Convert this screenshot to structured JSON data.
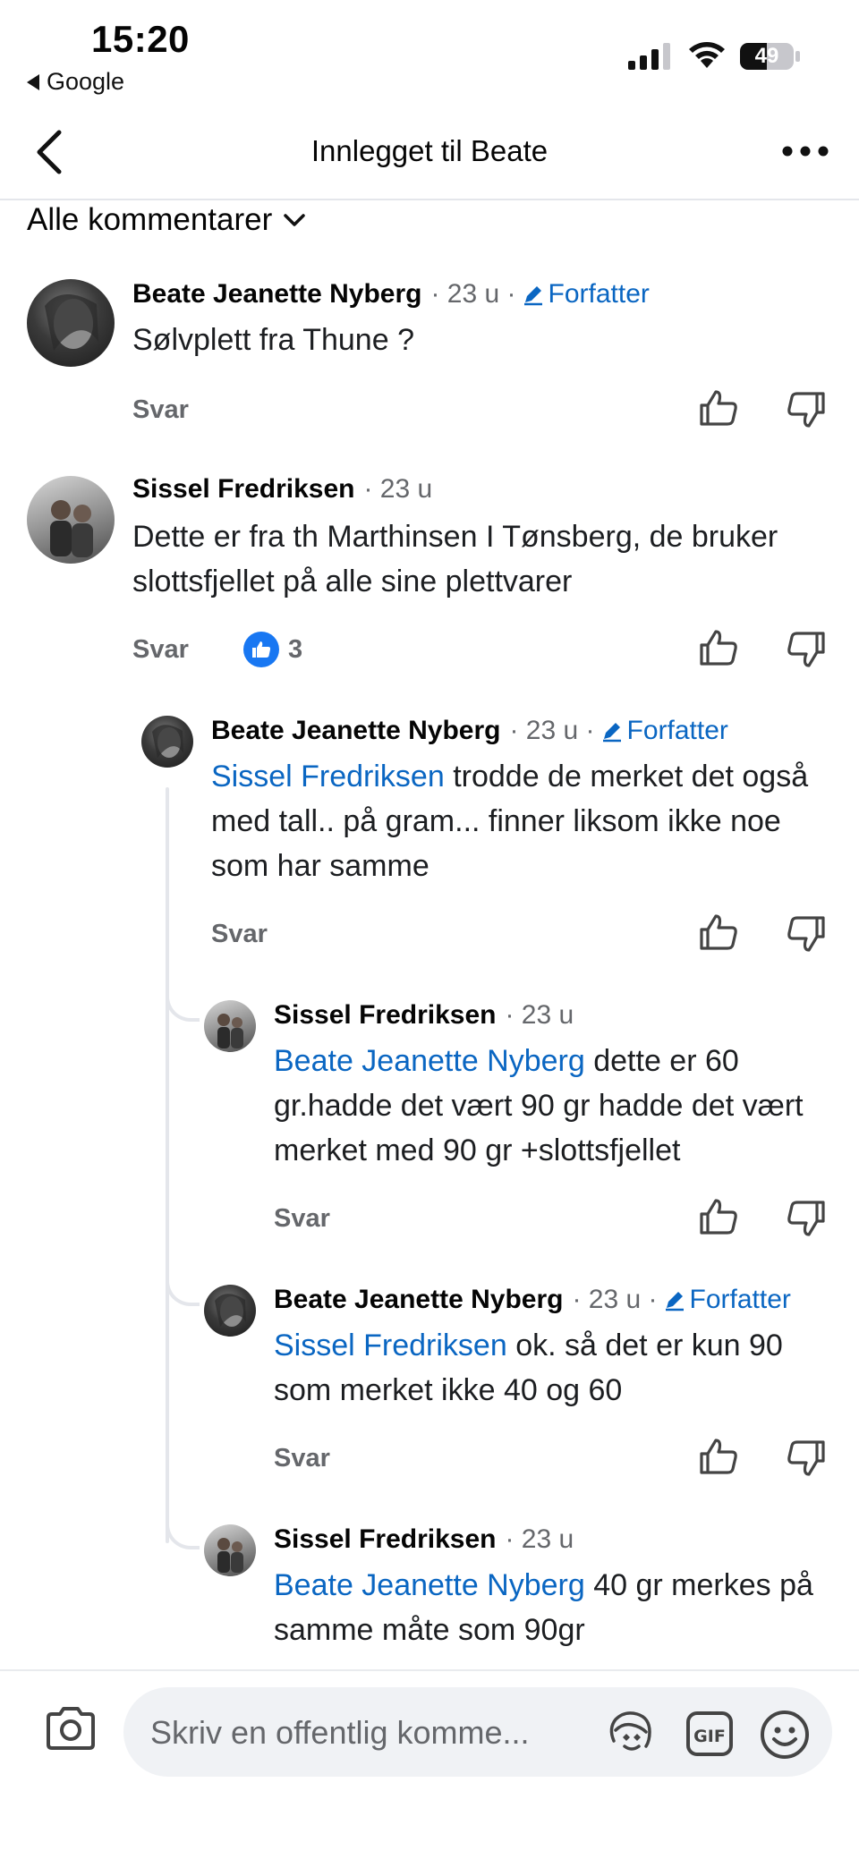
{
  "status_bar": {
    "time": "15:20",
    "back_app": "Google",
    "battery": "49"
  },
  "header": {
    "title": "Innlegget til Beate"
  },
  "filter": {
    "label": "Alle kommentarer"
  },
  "actions": {
    "reply": "Svar"
  },
  "comments": [
    {
      "name": "Beate Jeanette Nyberg",
      "meta": "· 23 u ·",
      "author_badge": "Forfatter",
      "text": "Sølvplett fra Thune ?"
    },
    {
      "name": "Sissel Fredriksen",
      "meta": "· 23 u",
      "text": "Dette er fra th Marthinsen I Tønsberg, de bruker slottsfjellet  på alle sine plettvarer",
      "reactions": "3"
    },
    {
      "name": "Beate Jeanette Nyberg",
      "meta": "· 23 u ·",
      "author_badge": "Forfatter",
      "mention": "Sissel Fredriksen",
      "text": "  trodde de merket det også med tall.. på gram... finner liksom ikke noe  som har samme"
    },
    {
      "name": "Sissel Fredriksen",
      "meta": "· 23 u",
      "mention": "Beate Jeanette Nyberg",
      "text": " dette er 60 gr.hadde det vært 90 gr hadde det vært merket med 90 gr +slottsfjellet"
    },
    {
      "name": "Beate Jeanette Nyberg",
      "meta": "· 23 u ·",
      "author_badge": "Forfatter",
      "mention": "Sissel Fredriksen",
      "text": "  ok. så det er kun 90 som merket ikke 40 og 60"
    },
    {
      "name": "Sissel Fredriksen",
      "meta": "· 23 u",
      "mention": "Beate Jeanette Nyberg",
      "text": " 40 gr merkes på samme måte som 90gr"
    }
  ],
  "composer": {
    "placeholder": "Skriv en offentlig komme..."
  },
  "colors": {
    "link": "#0a66c2",
    "muted": "#65676b",
    "like_blue": "#1877f2",
    "divider": "#e4e6eb"
  },
  "icons": [
    "back-chevron-icon",
    "more-icon",
    "chevron-down-icon",
    "pencil-icon",
    "thumbs-up-icon",
    "thumbs-down-icon",
    "camera-icon",
    "avatar-sticker-icon",
    "gif-icon",
    "emoji-icon"
  ]
}
